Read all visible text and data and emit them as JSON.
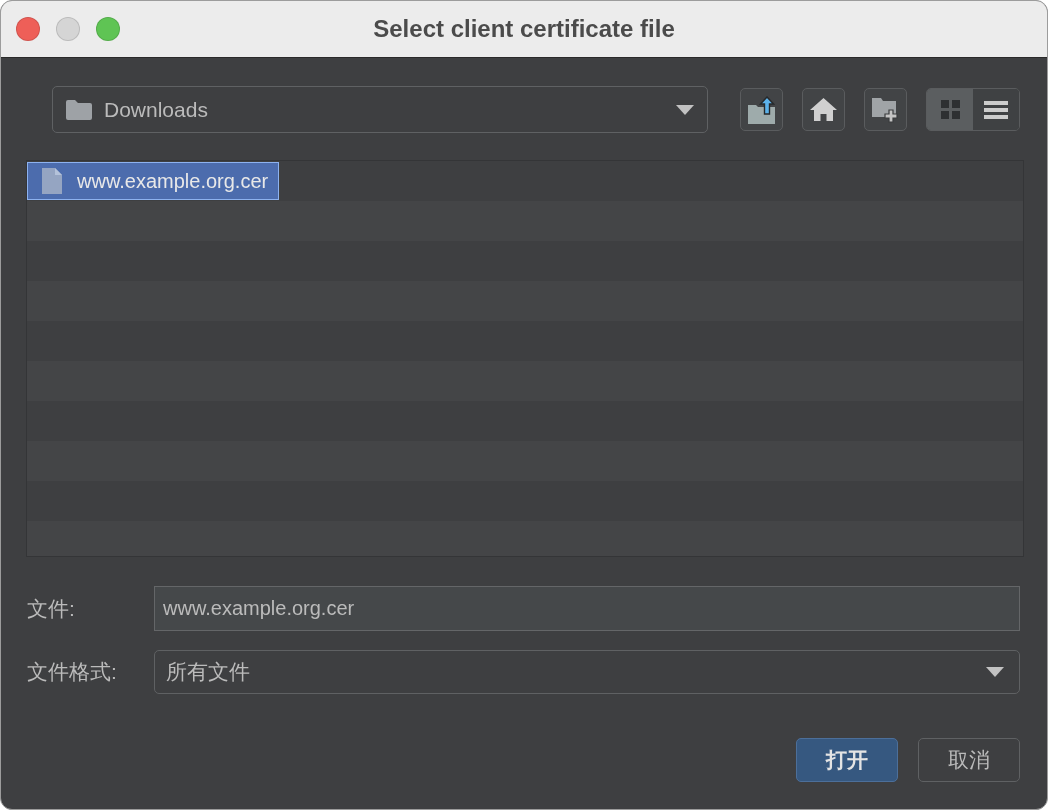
{
  "window": {
    "title": "Select client certificate file",
    "controls": [
      {
        "kind": "close",
        "disabled": false
      },
      {
        "kind": "minimize",
        "disabled": true
      },
      {
        "kind": "zoom",
        "disabled": false
      }
    ]
  },
  "toolbar": {
    "location": "Downloads",
    "view_modes": [
      {
        "kind": "grid",
        "selected": true
      },
      {
        "kind": "list",
        "selected": false
      }
    ]
  },
  "files": [
    {
      "name": "www.example.org.cer",
      "selected": true
    }
  ],
  "fields": {
    "file_name": {
      "label": "文件:",
      "value": "www.example.org.cer"
    },
    "file_format": {
      "label": "文件格式:",
      "value": "所有文件"
    }
  },
  "buttons": [
    {
      "label": "打开",
      "kind": "primary"
    },
    {
      "label": "取消",
      "kind": "secondary"
    }
  ]
}
